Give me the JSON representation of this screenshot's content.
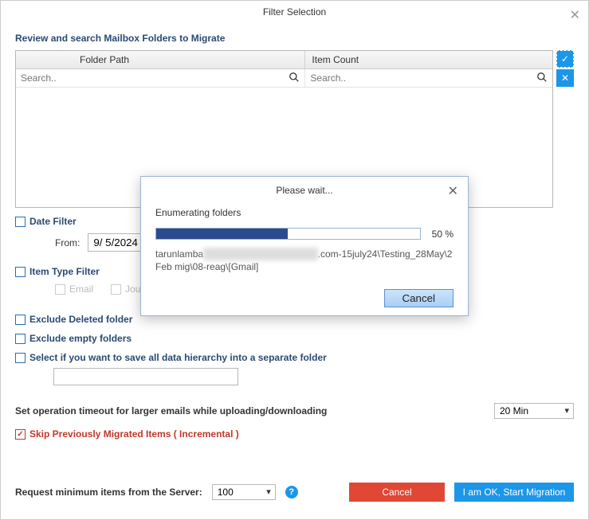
{
  "window": {
    "title": "Filter Selection",
    "close_glyph": "✕"
  },
  "review_label": "Review and search Mailbox Folders to Migrate",
  "grid": {
    "col_path": "Folder Path",
    "col_count": "Item Count",
    "search_placeholder": "Search.."
  },
  "side": {
    "checkall_glyph": "✓",
    "uncheckall_glyph": "✕"
  },
  "date_filter": {
    "label": "Date Filter",
    "from_label": "From:",
    "from_value": "9/ 5/2024"
  },
  "item_filter": {
    "label": "Item Type Filter",
    "types": [
      "Email",
      "Journal"
    ]
  },
  "exclude_deleted": "Exclude Deleted folder",
  "exclude_empty": "Exclude empty folders",
  "save_hierarchy": "Select if you want to save all data hierarchy into a separate folder",
  "timeout": {
    "label": "Set operation timeout for larger emails while uploading/downloading",
    "value": "20 Min"
  },
  "skip_prev": "Skip Previously Migrated Items ( Incremental )",
  "request_items": {
    "label": "Request minimum items from the Server:",
    "value": "100"
  },
  "help_glyph": "?",
  "footer": {
    "cancel": "Cancel",
    "ok": "I am OK, Start Migration"
  },
  "modal": {
    "title": "Please wait...",
    "close_glyph": "✕",
    "status": "Enumerating folders",
    "percent": "50 %",
    "progress_width": "50%",
    "path_prefix": "tarunlamba",
    "path_blur": "@blurred-domain-redacted",
    "path_suffix": ".com-15july24\\Testing_28May\\2 Feb mig\\08-reag\\[Gmail]",
    "cancel": "Cancel"
  }
}
